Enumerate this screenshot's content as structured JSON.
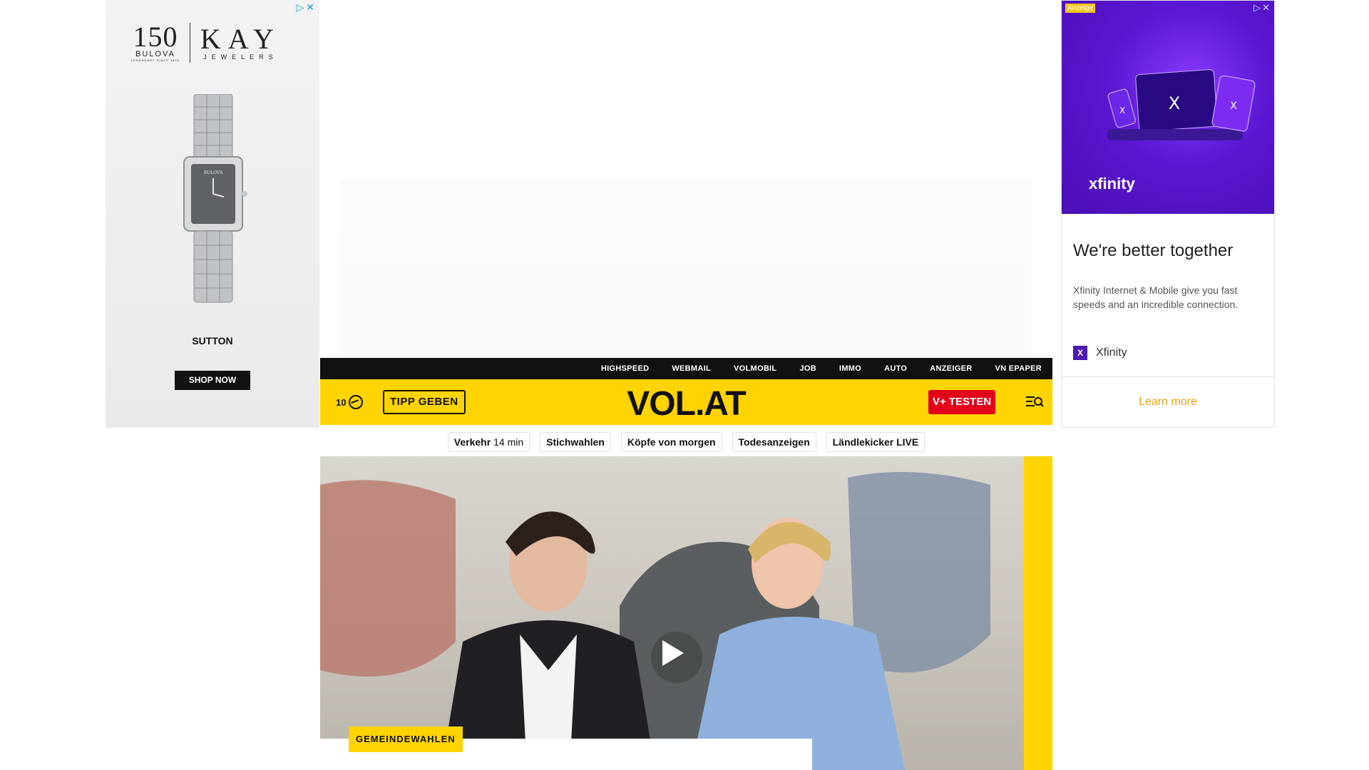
{
  "ad_left": {
    "brand_bulova": "150",
    "brand_bulova_name": "BULOVA",
    "brand_bulova_tagline": "LEGENDARY SINCE 1875",
    "brand_kay": "KAY",
    "brand_kay_sub": "JEWELERS",
    "watch_brand": "BULOVA",
    "product": "SUTTON",
    "cta": "SHOP NOW"
  },
  "ad_right": {
    "label": "Anzeige",
    "logo": "xfinity",
    "heading": "We're better together",
    "text": "Xfinity Internet & Mobile give you fast speeds and an incredible connection.",
    "advertiser_badge": "X",
    "advertiser": "Xfinity",
    "cta": "Learn more",
    "accent_color": "#e8a317"
  },
  "topbar": {
    "links": [
      "HIGHSPEED",
      "WEBMAIL",
      "VOLMOBIL",
      "JOB",
      "IMMO",
      "AUTO",
      "ANZEIGER",
      "VN EPAPER"
    ]
  },
  "header": {
    "temperature": "10",
    "tipp_label": "TIPP GEBEN",
    "logo": "VOL.AT",
    "vplus_label": "V+ TESTEN",
    "brand_color": "#ffd400",
    "cta_color": "#e3001b"
  },
  "quicklinks": [
    {
      "label": "Verkehr",
      "sub": "14 min"
    },
    {
      "label": "Stichwahlen"
    },
    {
      "label": "Köpfe von morgen"
    },
    {
      "label": "Todesanzeigen"
    },
    {
      "label": "Ländlekicker LIVE"
    }
  ],
  "hero": {
    "tag": "GEMEINDEWAHLEN"
  }
}
